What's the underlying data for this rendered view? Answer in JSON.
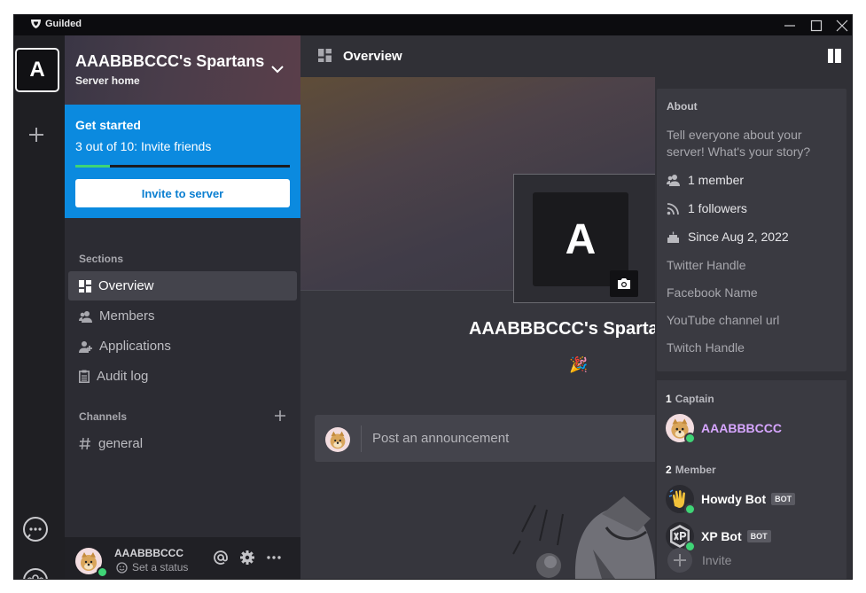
{
  "app": {
    "title": "Guilded"
  },
  "rail": {
    "server_initial": "A"
  },
  "sidebar": {
    "server_name": "AAABBBCCC's Spartans",
    "server_subtitle": "Server home",
    "get_started": {
      "title": "Get started",
      "progress_text": "3 out of 10: Invite friends",
      "progress_fraction": 0.3,
      "invite_button": "Invite to server"
    },
    "sections_label": "Sections",
    "sections": [
      {
        "label": "Overview",
        "icon": "overview-icon",
        "active": true
      },
      {
        "label": "Members",
        "icon": "members-icon",
        "active": false
      },
      {
        "label": "Applications",
        "icon": "applications-icon",
        "active": false
      },
      {
        "label": "Audit log",
        "icon": "audit-log-icon",
        "active": false
      }
    ],
    "channels_label": "Channels",
    "channels": [
      {
        "label": "general",
        "icon": "hash-icon"
      }
    ]
  },
  "userbar": {
    "username": "AAABBBCCC",
    "status": "Set a status"
  },
  "main": {
    "header_title": "Overview",
    "server_initial": "A",
    "server_name": "AAABBBCCC's Spartans",
    "party_emoji": "🎉",
    "announce_placeholder": "Post an announcement"
  },
  "about": {
    "title": "About",
    "description": "Tell everyone about your server! What's your story?",
    "members": "1 member",
    "followers": "1 followers",
    "since": "Since Aug 2, 2022",
    "links": [
      "Twitter Handle",
      "Facebook Name",
      "YouTube channel url",
      "Twitch Handle"
    ]
  },
  "member_list": {
    "groups": [
      {
        "count": "1",
        "name": "Captain"
      },
      {
        "count": "2",
        "name": "Member"
      }
    ],
    "members": [
      {
        "name": "AAABBBCCC",
        "role": "captain",
        "bot": false
      },
      {
        "name": "Howdy Bot",
        "role": "member",
        "bot": true
      },
      {
        "name": "XP Bot",
        "role": "member",
        "bot": true
      }
    ],
    "bot_tag": "BOT",
    "invite_label": "Invite"
  },
  "colors": {
    "accent_blue": "#0b8adf",
    "online_green": "#3fd476",
    "captain_purple": "#d7a6ff"
  }
}
